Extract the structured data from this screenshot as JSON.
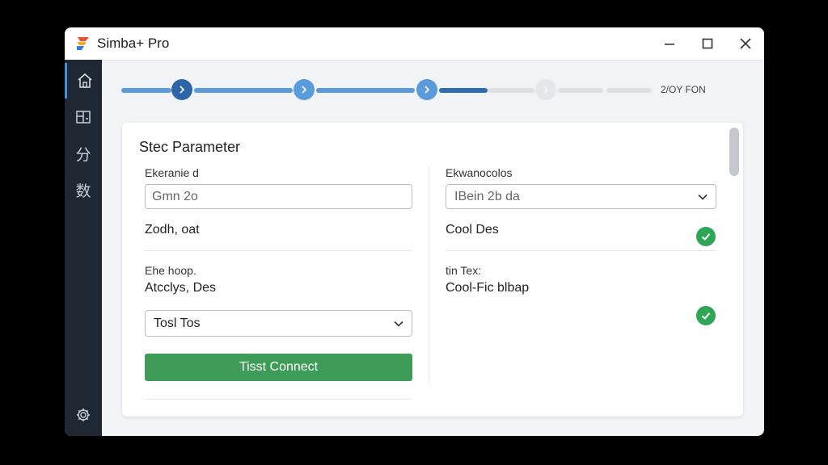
{
  "app": {
    "title": "Simba+ Pro",
    "accent": "#2e65a8",
    "success": "#2ea655"
  },
  "sidebar": {
    "items": [
      {
        "name": "home",
        "icon": "home-icon"
      },
      {
        "name": "diagram",
        "icon": "diagram-icon",
        "glyph": "⊞"
      },
      {
        "name": "split",
        "icon": "fen-glyph-icon",
        "glyph": "分"
      },
      {
        "name": "data",
        "icon": "shu-glyph-icon",
        "glyph": "数"
      }
    ],
    "settings_icon": "gear-icon"
  },
  "stepper": {
    "label": "2/OY FON",
    "completed_steps": 3,
    "total_steps": 4
  },
  "panel": {
    "title": "Stec Parameter",
    "left": {
      "field1_label": "Ekeranie d",
      "field1_value": "Gmn 2o",
      "field1_note": "Zodh, oat",
      "field2_label": "Ehe hoop.",
      "field2_value": "Atcclys, Des",
      "select_value": "Tosl Tos",
      "button_label": "Tisst Connect"
    },
    "right": {
      "field1_label": "Ekwanocolos",
      "select_value": "IBein 2b da",
      "status1": "Cool Des",
      "field2_label": "tin Tex:",
      "status2": "Cool-Fic blbap"
    }
  }
}
